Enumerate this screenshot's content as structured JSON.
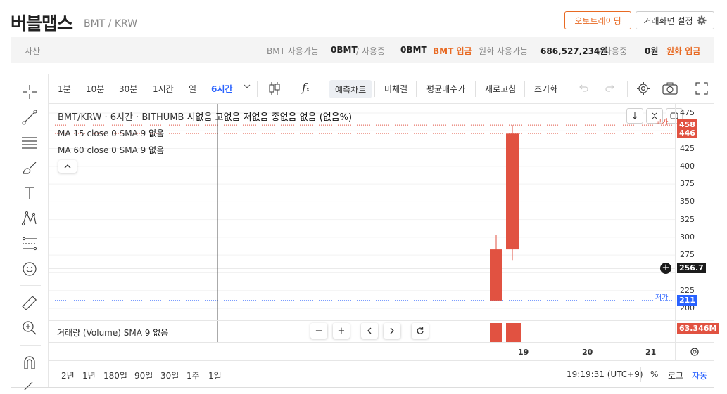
{
  "header": {
    "title": "버블맵스",
    "subtitle": "BMT / KRW",
    "auto_trade_label": "오토트레이딩",
    "screen_settings_label": "거래화면 설정"
  },
  "assets": {
    "label": "자산",
    "bmt_available_label": "BMT 사용가능",
    "bmt_available_value": "0BMT",
    "bmt_in_use_label": "/ 사용중",
    "bmt_in_use_value": "0BMT",
    "bmt_deposit": "BMT 입금",
    "krw_available_label": "원화 사용가능",
    "krw_available_value": "686,527,234원",
    "krw_in_use_label": "/ 사용중",
    "krw_in_use_value": "0원",
    "krw_deposit": "원화 입금"
  },
  "toolbar": {
    "intervals": [
      "1분",
      "10분",
      "30분",
      "1시간",
      "일",
      "6시간"
    ],
    "active_interval": "6시간",
    "forecast": "예측차트",
    "unfilled": "미체결",
    "avg_price": "평균매수가",
    "refresh": "새로고침",
    "reset": "초기화"
  },
  "legend": {
    "symbol": "BMT/KRW · 6시간 · BITHUMB",
    "ohlc": "시없음 고없음 저없음 종없음 없음 (없음%)",
    "ma15": "MA 15 close 0 SMA 9",
    "ma15_value": "없음",
    "ma60": "MA 60 close 0 SMA 9",
    "ma60_value": "없음",
    "volume": "거래량 (Volume) SMA 9",
    "volume_value": "없음"
  },
  "price_axis": {
    "ticks": [
      "475",
      "425",
      "400",
      "375",
      "350",
      "325",
      "300",
      "275",
      "225",
      "200"
    ],
    "high_tag": "고가",
    "low_tag": "저가",
    "label_high": "458",
    "label_close": "446",
    "label_cursor": "256.7",
    "label_low": "211",
    "label_volume": "63.346M"
  },
  "time_axis": {
    "ticks": [
      "19",
      "20",
      "21"
    ]
  },
  "bottom": {
    "ranges": [
      "2년",
      "1년",
      "180일",
      "90일",
      "30일",
      "1주",
      "1일"
    ],
    "clock": "19:19:31 (UTC+9)",
    "percent": "%",
    "log": "로그",
    "auto": "자동"
  },
  "colors": {
    "accent": "#e86a23",
    "up": "#e15241",
    "blue": "#2962ff"
  },
  "chart_data": {
    "type": "candlestick",
    "candles": [
      {
        "open": 211,
        "high": 303,
        "low": 211,
        "close": 283
      },
      {
        "open": 283,
        "high": 458,
        "low": 268,
        "close": 446
      }
    ],
    "ylim": [
      190,
      480
    ],
    "current": 256.7
  }
}
